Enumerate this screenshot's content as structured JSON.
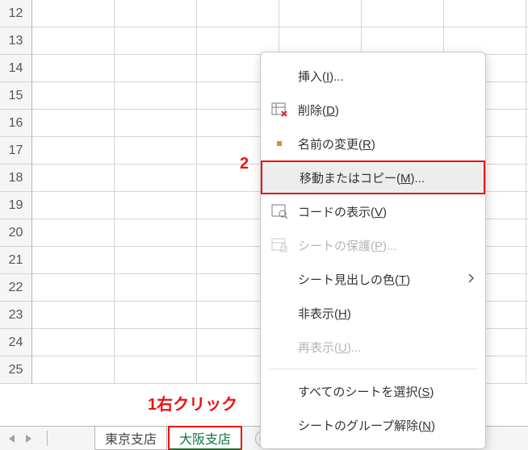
{
  "rows": [
    "12",
    "13",
    "14",
    "15",
    "16",
    "17",
    "18",
    "19",
    "20",
    "21",
    "22",
    "23",
    "24",
    "25"
  ],
  "tabs": {
    "scroll_left": "◀",
    "scroll_right": "▶",
    "sheet1": "東京支店",
    "sheet2": "大阪支店",
    "new_sheet": "+"
  },
  "annotations": {
    "label2": "2",
    "label1": "1右クリック"
  },
  "menu": {
    "insert": {
      "t": "挿入(",
      "m": "I",
      "s": ")..."
    },
    "delete": {
      "t": "削除(",
      "m": "D",
      "s": ")"
    },
    "rename": {
      "t": "名前の変更(",
      "m": "R",
      "s": ")"
    },
    "move_copy": {
      "t": "移動またはコピー(",
      "m": "M",
      "s": ")..."
    },
    "view_code": {
      "t": "コードの表示(",
      "m": "V",
      "s": ")"
    },
    "protect": {
      "t": "シートの保護(",
      "m": "P",
      "s": ")..."
    },
    "tab_color": {
      "t": "シート見出しの色(",
      "m": "T",
      "s": ")"
    },
    "hide": {
      "t": "非表示(",
      "m": "H",
      "s": ")"
    },
    "unhide": {
      "t": "再表示(",
      "m": "U",
      "s": ")..."
    },
    "select_all": {
      "t": "すべてのシートを選択(",
      "m": "S",
      "s": ")"
    },
    "ungroup": {
      "t": "シートのグループ解除(",
      "m": "N",
      "s": ")"
    }
  }
}
